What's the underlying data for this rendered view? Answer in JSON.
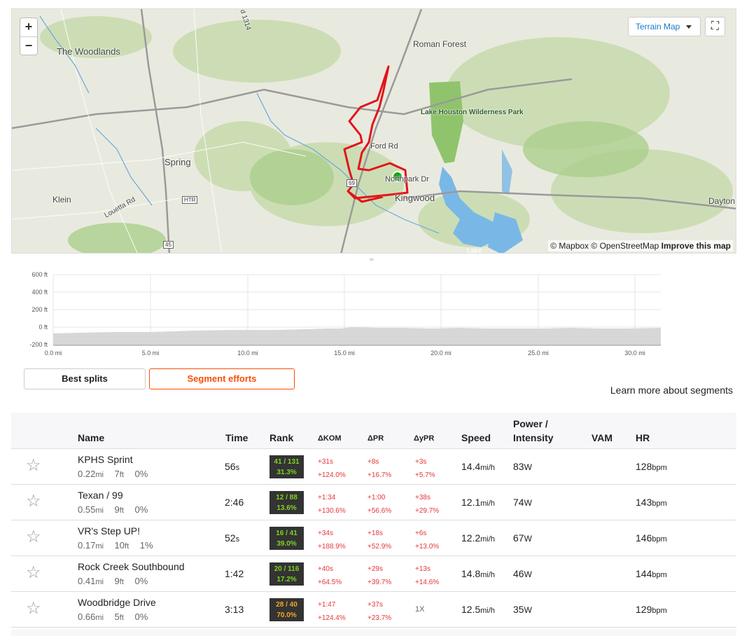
{
  "map": {
    "zoom_in": "+",
    "zoom_out": "−",
    "map_type": "Terrain Map",
    "fullscreen_icon": "⛶",
    "attribution_mapbox": "© Mapbox",
    "attribution_osm": "© OpenStreetMap",
    "attribution_improve": "Improve this map",
    "labels": {
      "the_woodlands": "The Woodlands",
      "roman_forest": "Roman Forest",
      "lake_houston_park": "Lake Houston Wilderness Park",
      "ford_rd": "Ford Rd",
      "spring": "Spring",
      "kingwood": "Kingwood",
      "northpark_dr": "Northpark Dr",
      "klein": "Klein",
      "louetta_rd": "Louetta Rd",
      "dayton": "Dayton",
      "lake": "Lake",
      "road_1314": "d 1314"
    },
    "shields": {
      "htr": "HTR",
      "i45": "45",
      "us69": "69"
    },
    "route_color": "#e3141a",
    "endpoint_color": "#1aa31a"
  },
  "elevation": {
    "y_ticks": [
      "600 ft",
      "400 ft",
      "200 ft",
      "0 ft",
      "-200 ft"
    ],
    "x_ticks": [
      "0.0 mi",
      "5.0 mi",
      "10.0 mi",
      "15.0 mi",
      "20.0 mi",
      "25.0 mi",
      "30.0 mi"
    ],
    "fill_color": "#d7d7d7"
  },
  "tabs": {
    "best_splits": "Best splits",
    "segment_efforts": "Segment efforts"
  },
  "learn_more": "Learn more about segments",
  "table": {
    "headers": {
      "name": "Name",
      "time": "Time",
      "rank": "Rank",
      "dkom": "ΔKOM",
      "dpr": "ΔPR",
      "dypr": "ΔyPR",
      "speed": "Speed",
      "power_line1": "Power /",
      "power_line2": "Intensity",
      "vam": "VAM",
      "hr": "HR"
    },
    "rows": [
      {
        "star_icon": "☆",
        "name": "KPHS Sprint",
        "dist": "0.22",
        "dist_unit": "mi",
        "elev": "7",
        "elev_unit": "ft",
        "grade": "0%",
        "time": "56",
        "time_unit": "s",
        "rank_line1": "41 / 131",
        "rank_line2": "31.3%",
        "rank_color": "green",
        "kom1": "+31s",
        "kom2": "+124.0%",
        "pr1": "+8s",
        "pr2": "+16.7%",
        "ypr1": "+3s",
        "ypr2": "+5.7%",
        "speed": "14.4",
        "speed_unit": "mi/h",
        "power": "83",
        "power_unit": "W",
        "hr": "128",
        "hr_unit": "bpm"
      },
      {
        "star_icon": "☆",
        "name": "Texan / 99",
        "dist": "0.55",
        "dist_unit": "mi",
        "elev": "9",
        "elev_unit": "ft",
        "grade": "0%",
        "time": "2:46",
        "time_unit": "",
        "rank_line1": "12 / 88",
        "rank_line2": "13.6%",
        "rank_color": "green",
        "kom1": "+1:34",
        "kom2": "+130.6%",
        "pr1": "+1:00",
        "pr2": "+56.6%",
        "ypr1": "+38s",
        "ypr2": "+29.7%",
        "speed": "12.1",
        "speed_unit": "mi/h",
        "power": "74",
        "power_unit": "W",
        "hr": "143",
        "hr_unit": "bpm"
      },
      {
        "star_icon": "☆",
        "name": "VR's Step UP!",
        "dist": "0.17",
        "dist_unit": "mi",
        "elev": "10",
        "elev_unit": "ft",
        "grade": "1%",
        "time": "52",
        "time_unit": "s",
        "rank_line1": "16 / 41",
        "rank_line2": "39.0%",
        "rank_color": "green",
        "kom1": "+34s",
        "kom2": "+188.9%",
        "pr1": "+18s",
        "pr2": "+52.9%",
        "ypr1": "+6s",
        "ypr2": "+13.0%",
        "speed": "12.2",
        "speed_unit": "mi/h",
        "power": "67",
        "power_unit": "W",
        "hr": "146",
        "hr_unit": "bpm"
      },
      {
        "star_icon": "☆",
        "name": "Rock Creek Southbound",
        "dist": "0.41",
        "dist_unit": "mi",
        "elev": "9",
        "elev_unit": "ft",
        "grade": "0%",
        "time": "1:42",
        "time_unit": "",
        "rank_line1": "20 / 116",
        "rank_line2": "17.2%",
        "rank_color": "green",
        "kom1": "+40s",
        "kom2": "+64.5%",
        "pr1": "+29s",
        "pr2": "+39.7%",
        "ypr1": "+13s",
        "ypr2": "+14.6%",
        "speed": "14.8",
        "speed_unit": "mi/h",
        "power": "46",
        "power_unit": "W",
        "hr": "144",
        "hr_unit": "bpm"
      },
      {
        "star_icon": "☆",
        "name": "Woodbridge Drive",
        "dist": "0.66",
        "dist_unit": "mi",
        "elev": "5",
        "elev_unit": "ft",
        "grade": "0%",
        "time": "3:13",
        "time_unit": "",
        "rank_line1": "28 / 40",
        "rank_line2": "70.0%",
        "rank_color": "orange",
        "kom1": "+1:47",
        "kom2": "+124.4%",
        "pr1": "+37s",
        "pr2": "+23.7%",
        "ypr1": "1X",
        "ypr2": "",
        "speed": "12.5",
        "speed_unit": "mi/h",
        "power": "35",
        "power_unit": "W",
        "hr": "129",
        "hr_unit": "bpm"
      }
    ]
  }
}
